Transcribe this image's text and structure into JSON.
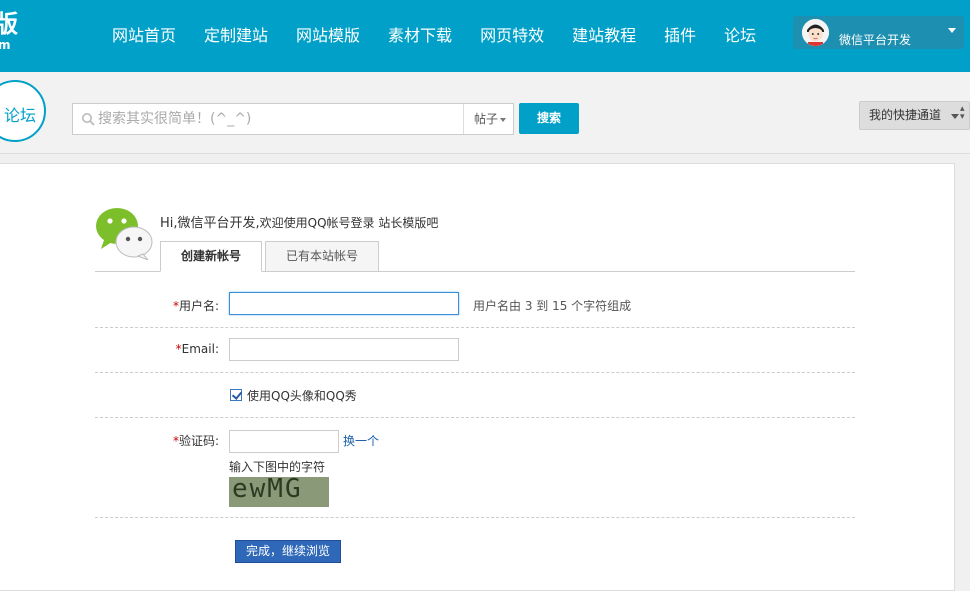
{
  "header": {
    "logo_big": "版",
    "logo_small": "m",
    "nav": [
      "网站首页",
      "定制建站",
      "网站模版",
      "素材下载",
      "网页特效",
      "建站教程",
      "插件",
      "论坛"
    ],
    "user_name": "微信平台开发"
  },
  "subbar": {
    "forum_badge": "论坛",
    "search_placeholder": "搜索其实很简单！(^_^)",
    "search_type": "帖子",
    "search_button": "搜索",
    "quick_channel": "我的快捷通道"
  },
  "login": {
    "greeting": "Hi,微信平台开发,",
    "greeting_sub": "欢迎使用QQ帐号登录 站长模版吧",
    "tabs": [
      "创建新帐号",
      "已有本站帐号"
    ],
    "username_label": "用户名:",
    "username_hint": "用户名由 3 到 15 个字符组成",
    "email_label": "Email:",
    "qq_avatar_label": "使用QQ头像和QQ秀",
    "captcha_label": "验证码:",
    "captcha_refresh": "换一个",
    "captcha_hint": "输入下图中的字符",
    "captcha_text": "ewMG",
    "submit": "完成，继续浏览"
  },
  "colors": {
    "brand": "#00a0c8",
    "required": "#c00000",
    "submit": "#2f68b8"
  }
}
